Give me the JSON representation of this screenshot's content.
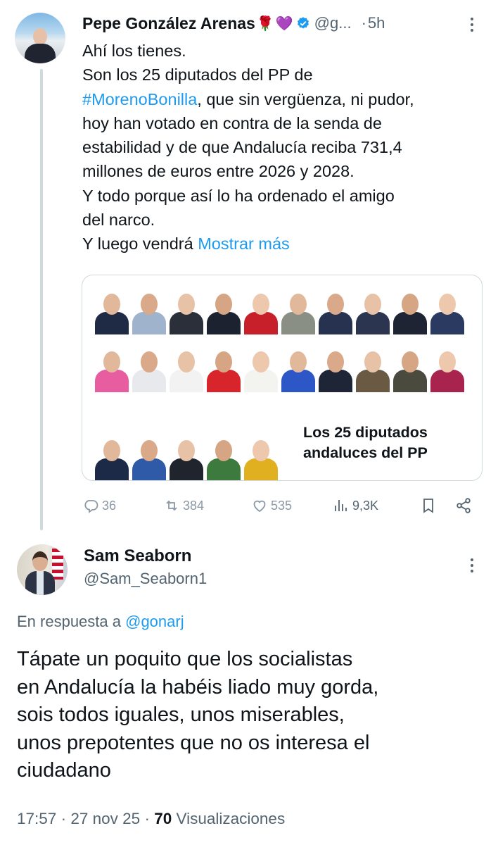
{
  "tweet1": {
    "author_name": "Pepe González Arenas",
    "emojis": [
      "🌹",
      "💜"
    ],
    "handle": "@g...",
    "separator": "·",
    "time": "5h",
    "text_lines": [
      "Ahí los tienes.",
      "Son los 25 diputados del PP de",
      ", que sin vergüenza, ni pudor,",
      "hoy han votado en contra de la senda de",
      "estabilidad y de que Andalucía reciba 731,4",
      "millones de euros entre 2026 y 2028.",
      "Y todo porque así lo ha ordenado el amigo",
      "del narco.",
      "Y luego vendrá "
    ],
    "hashtag": "#MorenoBonilla",
    "show_more": "Mostrar más",
    "card_title_line1": "Los 25 diputados",
    "card_title_line2": "andaluces del PP",
    "stats": {
      "replies": "36",
      "reposts": "384",
      "likes": "535",
      "views": "9,3K"
    }
  },
  "tweet2": {
    "author_name": "Sam Seaborn",
    "handle": "@Sam_Seaborn1",
    "reply_prefix": "En respuesta a ",
    "reply_handle": "@gonarj",
    "text_lines": [
      "Tápate un poquito que los socialistas",
      "en Andalucía la habéis liado muy gorda,",
      "sois todos iguales, unos miserables,",
      "unos prepotentes que no os interesa el",
      "ciudadano"
    ],
    "time": "17:57",
    "date": "27 nov 25",
    "dot": "·",
    "views_count": "70",
    "views_label": "Visualizaciones"
  },
  "colors": {
    "accent": "#1d9bf0",
    "muted": "#536471",
    "text": "#0f1419",
    "border": "#cfd9de"
  }
}
